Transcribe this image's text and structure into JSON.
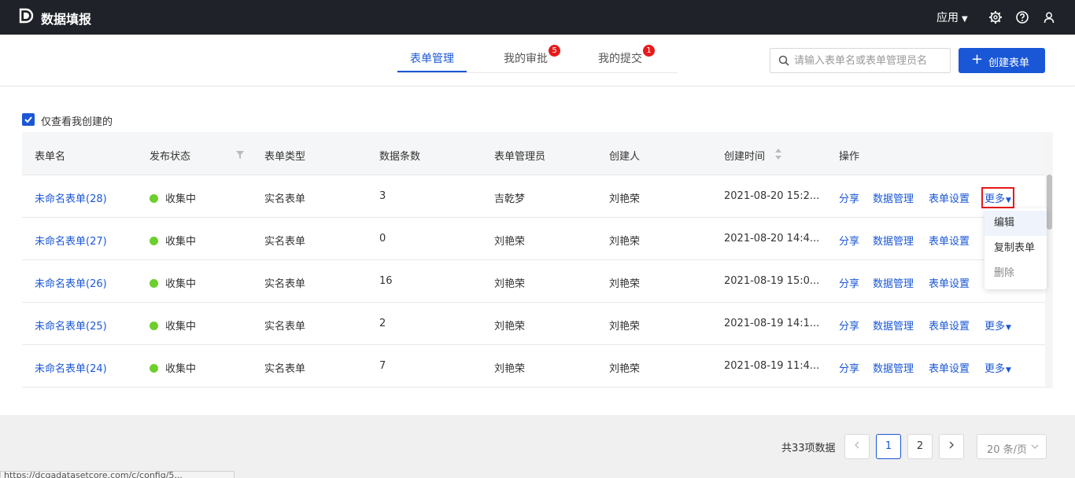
{
  "header": {
    "app_title": "数据填报",
    "apps_menu_label": "应用"
  },
  "tabs": [
    {
      "label": "表单管理",
      "active": true,
      "badge": ""
    },
    {
      "label": "我的审批",
      "active": false,
      "badge": "5"
    },
    {
      "label": "我的提交",
      "active": false,
      "badge": "1"
    }
  ],
  "search": {
    "placeholder": "请输入表单名或表单管理员名",
    "value": ""
  },
  "create_button_label": "创建表单",
  "filter": {
    "only_mine_label": "仅查看我创建的",
    "only_mine_checked": true
  },
  "table": {
    "columns": [
      "表单名",
      "发布状态",
      "表单类型",
      "数据条数",
      "表单管理员",
      "创建人",
      "创建时间",
      "操作"
    ],
    "rows": [
      {
        "name": "未命名表单(28)",
        "status": "收集中",
        "type": "实名表单",
        "count": "3",
        "admin": "吉乾梦",
        "creator": "刘艳荣",
        "created": "2021-08-20 15:2..."
      },
      {
        "name": "未命名表单(27)",
        "status": "收集中",
        "type": "实名表单",
        "count": "0",
        "admin": "刘艳荣",
        "creator": "刘艳荣",
        "created": "2021-08-20 14:4..."
      },
      {
        "name": "未命名表单(26)",
        "status": "收集中",
        "type": "实名表单",
        "count": "16",
        "admin": "刘艳荣",
        "creator": "刘艳荣",
        "created": "2021-08-19 15:0..."
      },
      {
        "name": "未命名表单(25)",
        "status": "收集中",
        "type": "实名表单",
        "count": "2",
        "admin": "刘艳荣",
        "creator": "刘艳荣",
        "created": "2021-08-19 14:1..."
      },
      {
        "name": "未命名表单(24)",
        "status": "收集中",
        "type": "实名表单",
        "count": "7",
        "admin": "刘艳荣",
        "creator": "刘艳荣",
        "created": "2021-08-19 11:4..."
      }
    ],
    "actions": {
      "share": "分享",
      "data_manage": "数据管理",
      "settings": "表单设置",
      "more": "更多"
    }
  },
  "more_menu": {
    "items": [
      "编辑",
      "复制表单",
      "删除"
    ]
  },
  "pagination": {
    "total_text": "共33项数据",
    "pages": [
      "1",
      "2"
    ],
    "current_page": "1",
    "page_size": "20 条/页"
  },
  "status_bar": {
    "url_text": "https://dcqadatasetcore.com/c/config/5..."
  },
  "colors": {
    "topbar": "#1f2329",
    "accent": "#1a57d6",
    "badge": "#e8191a",
    "status_dot": "#6ccf2c"
  }
}
